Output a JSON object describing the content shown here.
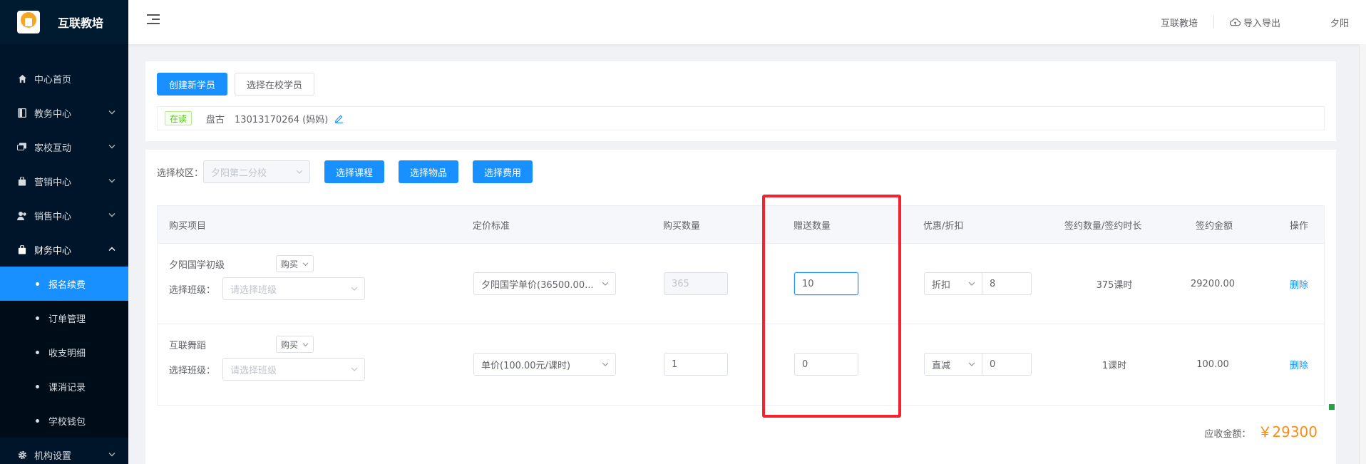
{
  "brand": {
    "name": "互联教培",
    "logo_icon": "school-logo"
  },
  "sidebar": {
    "items": [
      {
        "label": "中心首页",
        "icon": "home-icon",
        "expandable": false
      },
      {
        "label": "教务中心",
        "icon": "book-icon",
        "expandable": true
      },
      {
        "label": "家校互动",
        "icon": "chat-icon",
        "expandable": true
      },
      {
        "label": "营销中心",
        "icon": "bag-icon",
        "expandable": true
      },
      {
        "label": "销售中心",
        "icon": "people-icon",
        "expandable": true
      },
      {
        "label": "财务中心",
        "icon": "wallet-icon",
        "expandable": true,
        "open": true
      }
    ],
    "sub_items": [
      {
        "label": "报名续费",
        "active": true
      },
      {
        "label": "订单管理"
      },
      {
        "label": "收支明细"
      },
      {
        "label": "课消记录"
      },
      {
        "label": "学校钱包"
      }
    ],
    "footer_item": {
      "label": "机构设置",
      "icon": "gear-icon"
    }
  },
  "header": {
    "menu_toggle_icon": "menu-fold-icon",
    "org_label": "互联教培",
    "import_export_label": "导入导出",
    "import_export_icon": "cloud-icon",
    "user_name": "夕阳"
  },
  "student_section": {
    "create_button": "创建新学员",
    "select_button": "选择在校学员",
    "status_tag": "在读",
    "student_name": "盘古",
    "student_phone": "13013170264 (妈妈)"
  },
  "order_section": {
    "campus_label": "选择校区：",
    "campus_value": "夕阳第二分校",
    "select_course_button": "选择课程",
    "select_item_button": "选择物品",
    "select_fee_button": "选择费用"
  },
  "table": {
    "headers": [
      "购买项目",
      "定价标准",
      "购买数量",
      "赠送数量",
      "优惠/折扣",
      "签约数量/签约时长",
      "签约金额",
      "操作"
    ],
    "class_label": "选择班级：",
    "class_placeholder": "请选择班级",
    "rows": [
      {
        "name": "夕阳国学初级",
        "type": "购买",
        "pricing": "夕阳国学单价(36500.00...",
        "quantity": "365",
        "gift": "10",
        "discount_type": "折扣",
        "discount_value": "8",
        "contract": "375课时",
        "amount": "29200.00",
        "action": "删除"
      },
      {
        "name": "互联舞蹈",
        "type": "购买",
        "pricing": "单价(100.00元/课时)",
        "quantity": "1",
        "gift": "0",
        "discount_type": "直减",
        "discount_value": "0",
        "contract": "1课时",
        "amount": "100.00",
        "action": "删除"
      }
    ]
  },
  "total": {
    "label": "应收金额：",
    "value": "￥29300"
  },
  "colors": {
    "primary": "#1890ff",
    "sidebar_bg": "#001529",
    "highlight": "#f5222d",
    "amount": "#fa8c16"
  }
}
